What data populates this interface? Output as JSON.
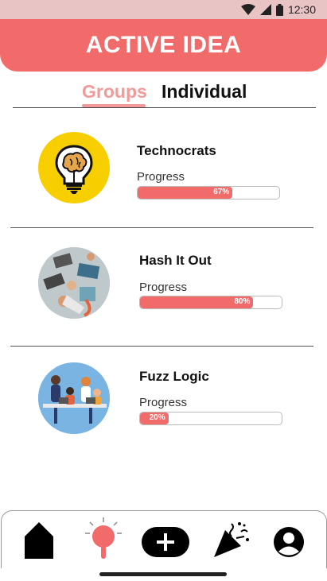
{
  "status_bar": {
    "time": "12:30"
  },
  "header": {
    "title": "ACTIVE IDEA"
  },
  "tabs": [
    {
      "label": "Groups",
      "active": true
    },
    {
      "label": "Individual",
      "active": false
    }
  ],
  "groups": [
    {
      "name": "Technocrats",
      "progress_label": "Progress",
      "progress": 67,
      "progress_text": "67%"
    },
    {
      "name": "Hash It Out",
      "progress_label": "Progress",
      "progress": 80,
      "progress_text": "80%"
    },
    {
      "name": "Fuzz Logic",
      "progress_label": "Progress",
      "progress": 20,
      "progress_text": "20%"
    }
  ],
  "colors": {
    "accent": "#f26b6b",
    "tab_active": "#f29a9a",
    "status_bar": "#e8c4c4"
  },
  "bottom_nav": [
    {
      "icon": "home-icon"
    },
    {
      "icon": "idea-bulb-icon"
    },
    {
      "icon": "add-icon"
    },
    {
      "icon": "party-popper-icon"
    },
    {
      "icon": "profile-icon"
    }
  ]
}
